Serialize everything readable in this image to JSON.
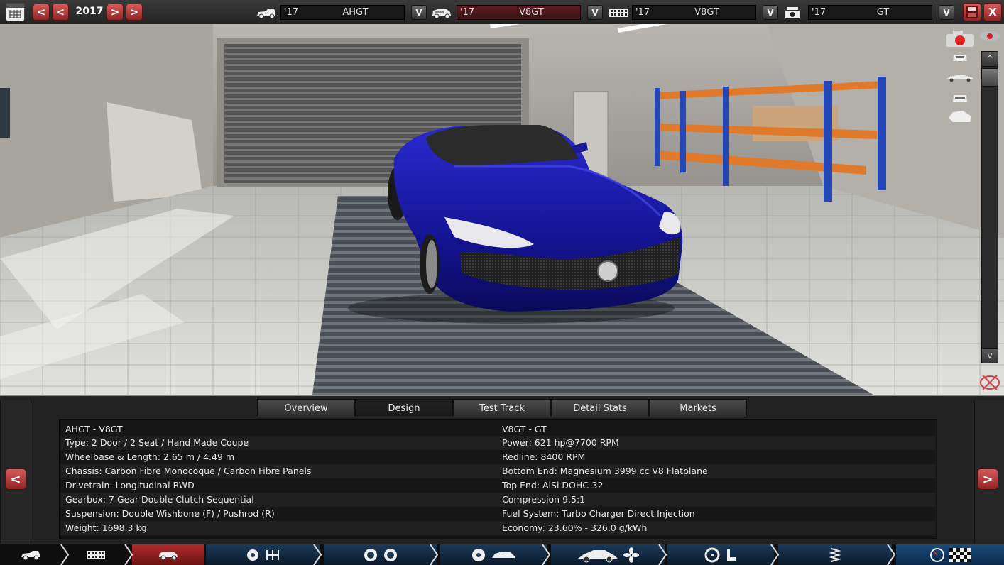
{
  "topbar": {
    "year": "2017",
    "prev_year_label": "<",
    "prev_year2_label": "<",
    "next_year_label": ">",
    "next_year2_label": ">",
    "selectors": [
      {
        "year": "'17",
        "name": "AHGT",
        "dropdown": "V"
      },
      {
        "year": "'17",
        "name": "V8GT",
        "dropdown": "V"
      },
      {
        "year": "'17",
        "name": "V8GT",
        "dropdown": "V"
      },
      {
        "year": "'17",
        "name": "GT",
        "dropdown": "V"
      }
    ],
    "close_label": "X"
  },
  "viewport": {
    "scroll_up": "^",
    "scroll_down": "v"
  },
  "tabs": [
    {
      "label": "Overview"
    },
    {
      "label": "Design"
    },
    {
      "label": "Test Track"
    },
    {
      "label": "Detail Stats"
    },
    {
      "label": "Markets"
    }
  ],
  "stats": {
    "left": [
      "AHGT - V8GT",
      "Type: 2 Door / 2 Seat / Hand Made Coupe",
      "Wheelbase & Length: 2.65 m / 4.49 m",
      "Chassis: Carbon Fibre Monocoque / Carbon Fibre Panels",
      "Drivetrain: Longitudinal RWD",
      "Gearbox: 7 Gear Double Clutch Sequential",
      "Suspension: Double Wishbone (F) / Pushrod (R)",
      "Weight: 1698.3 kg"
    ],
    "right": [
      "V8GT - GT",
      "Power: 621 hp@7700 RPM",
      "Redline: 8400 RPM",
      "Bottom End: Magnesium 3999 cc V8 Flatplane",
      "Top End: AlSi DOHC-32",
      "Compression 9.5:1",
      "Fuel System: Turbo Charger Direct Injection",
      "Economy: 23.60% - 326.0 g/kWh"
    ]
  },
  "panel": {
    "prev_label": "<",
    "next_label": ">"
  },
  "colors": {
    "accent_red": "#b23434",
    "car_blue": "#1a1aa0",
    "rack_orange": "#e07a2a",
    "rack_blue": "#2346b8"
  }
}
